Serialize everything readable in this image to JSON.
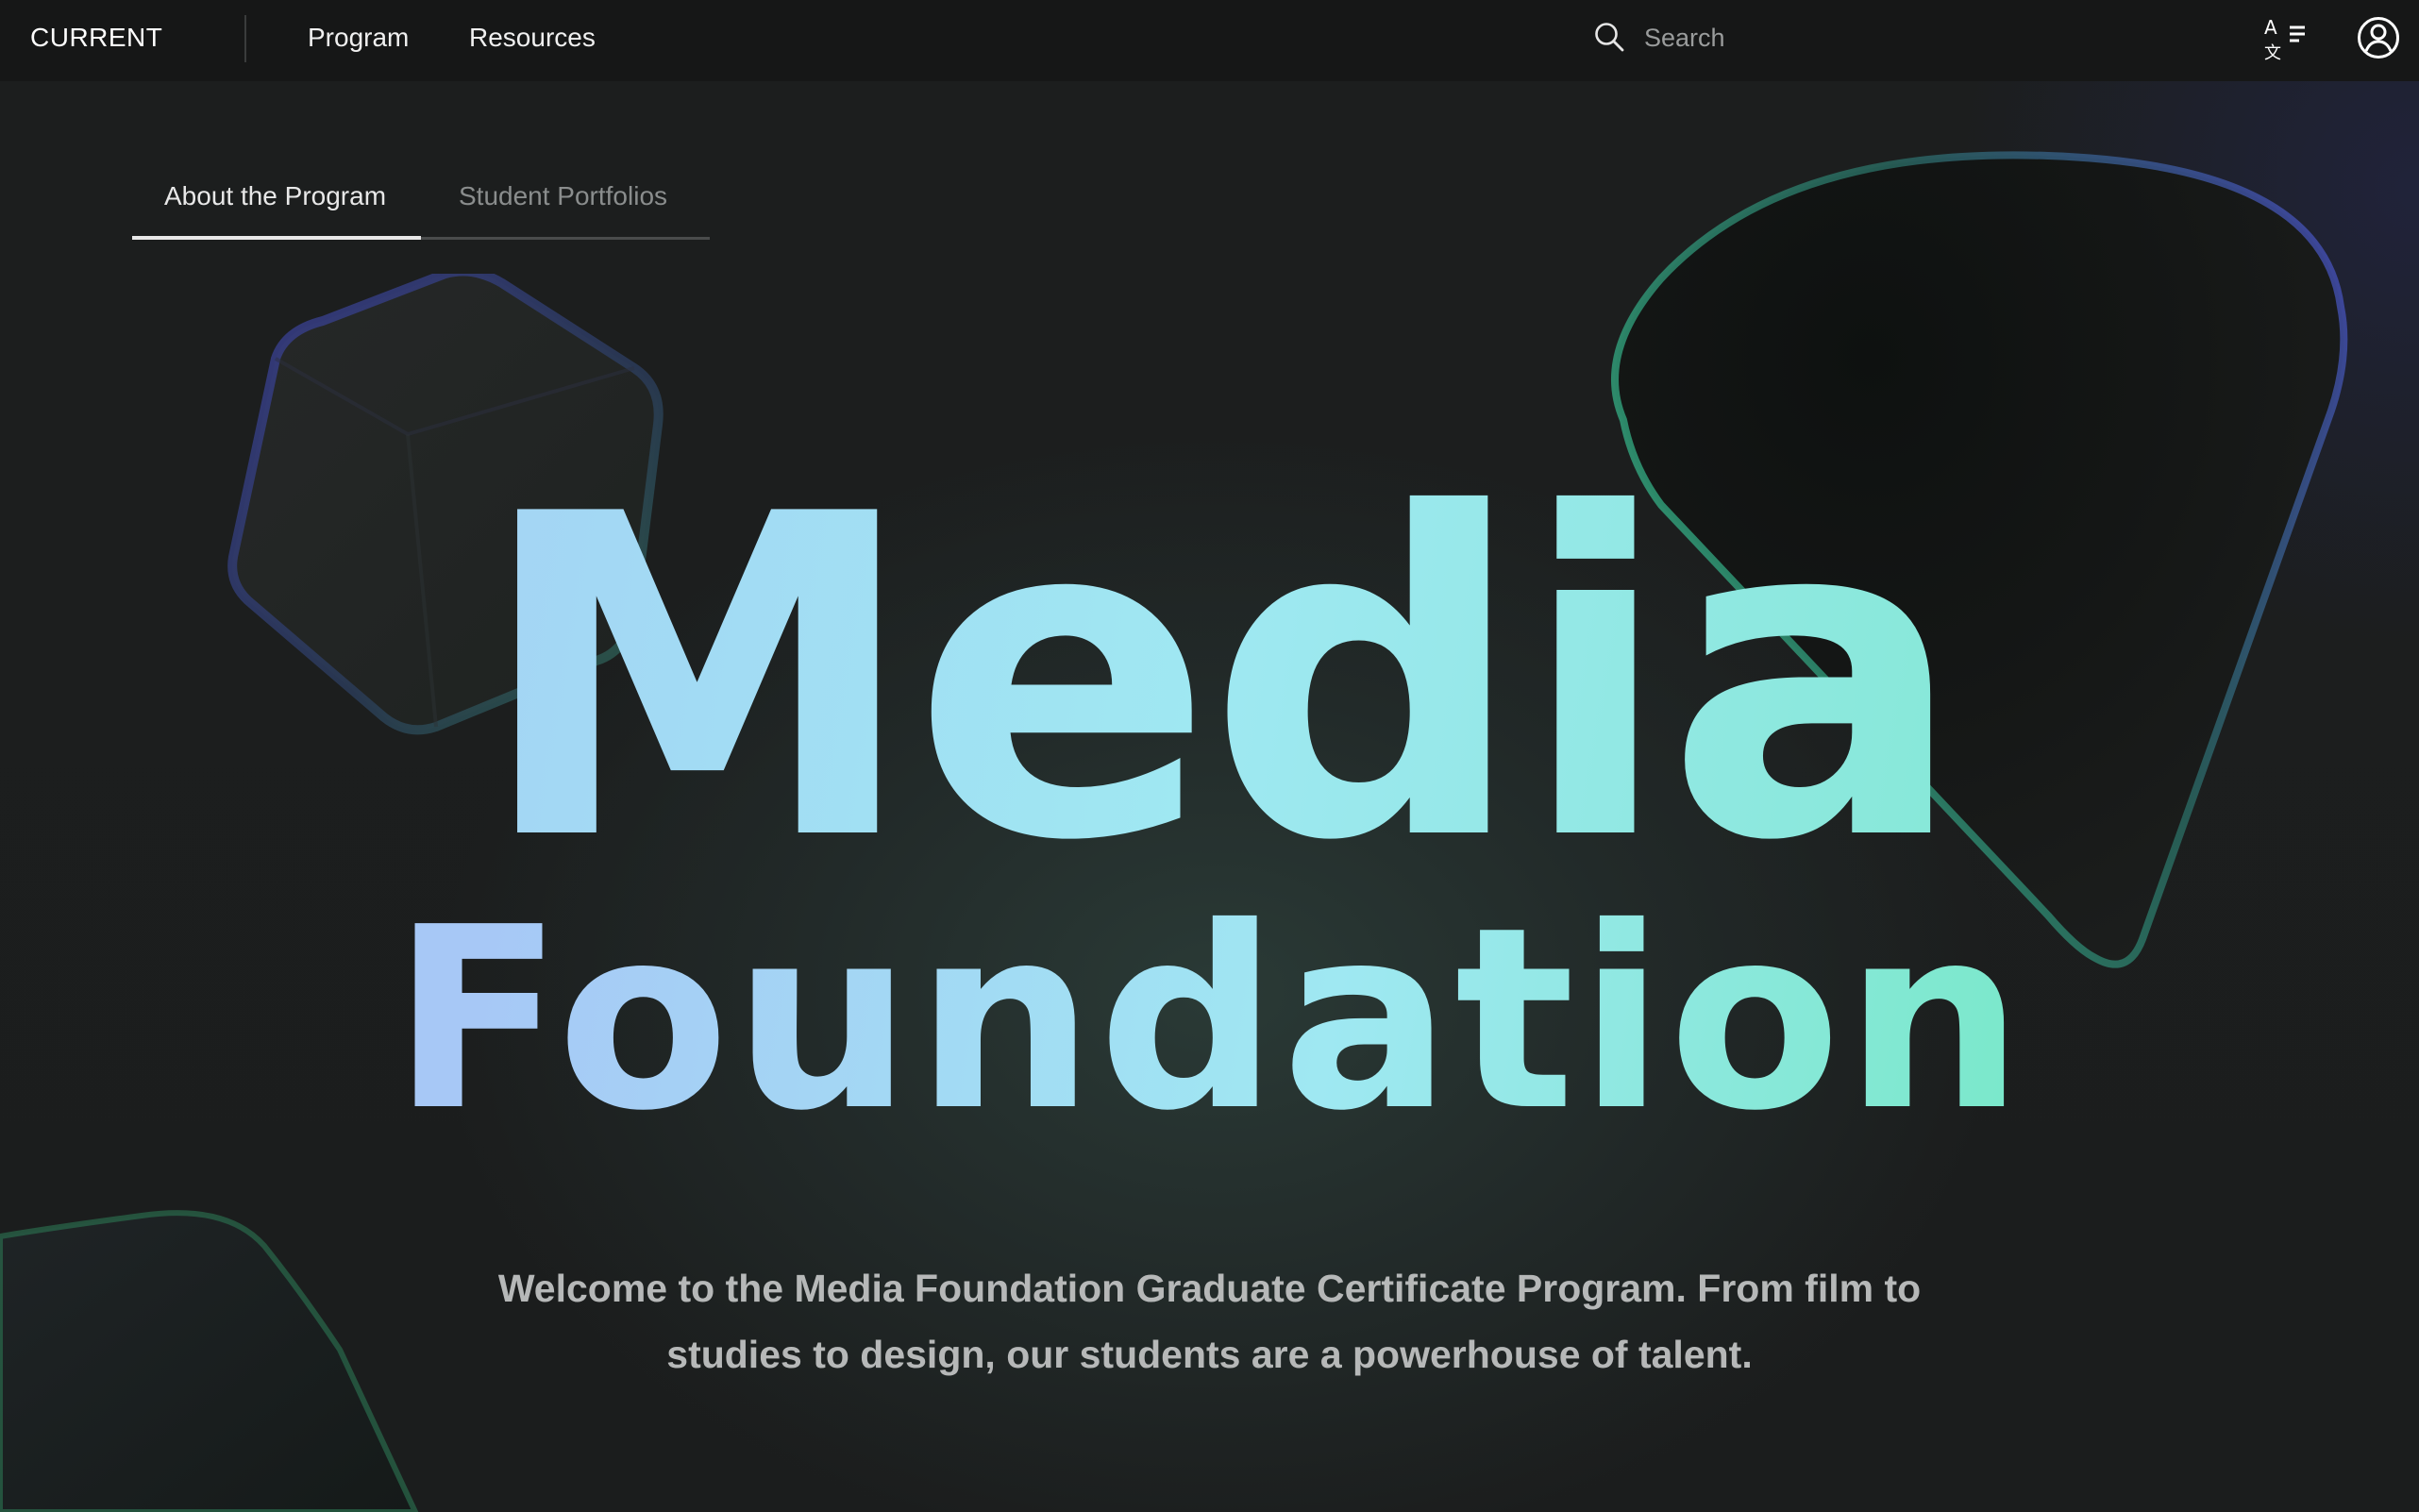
{
  "header": {
    "brand": "CURRENT",
    "nav": [
      "Program",
      "Resources"
    ],
    "search": {
      "placeholder": "Search",
      "value": ""
    },
    "icons": {
      "search": "search-icon",
      "translate": "translate-icon",
      "account": "user-account-icon"
    }
  },
  "tabs": {
    "items": [
      {
        "label": "About the Program",
        "active": true
      },
      {
        "label": "Student Portfolios",
        "active": false
      }
    ]
  },
  "hero": {
    "title": "Media",
    "subtitle": "Foundation",
    "intro": "Welcome to the Media Foundation Graduate Certificate Program. From film to studies to design, our students are a powerhouse of talent."
  },
  "colors": {
    "background": "#1b1d1d",
    "topbar": "#161717",
    "gradient_start": "#a7c8f6",
    "gradient_mid": "#9fe8f2",
    "gradient_end": "#78e8c8",
    "shape_edge_blue": "#3a3fa0",
    "shape_edge_green": "#2f8a6a"
  }
}
